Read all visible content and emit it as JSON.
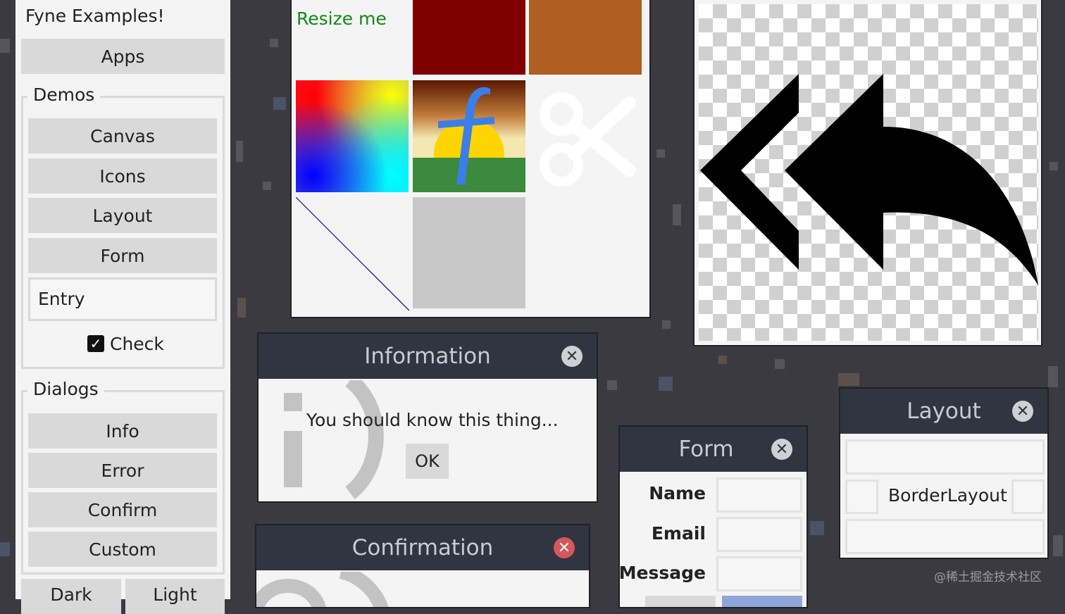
{
  "sidebar": {
    "title": "Fyne Examples!",
    "apps_label": "Apps",
    "demos_group": "Demos",
    "demos": [
      "Canvas",
      "Icons",
      "Layout",
      "Form"
    ],
    "entry_placeholder": "Entry",
    "check_label": "Check",
    "check_checked": true,
    "dialogs_group": "Dialogs",
    "dialogs": [
      "Info",
      "Error",
      "Confirm",
      "Custom"
    ],
    "theme_buttons": [
      "Dark",
      "Light"
    ]
  },
  "canvas_window": {
    "resize_text": "Resize me",
    "colors": {
      "dark_red": "#800000",
      "orange": "#b05e22",
      "text_green": "#138913",
      "gray": "#c8c8c8",
      "line": "#1a1aa0"
    }
  },
  "icon_window": {
    "icon": "mail-reply-all-icon"
  },
  "info_dialog": {
    "title": "Information",
    "message": "You should know this thing...",
    "ok_label": "OK"
  },
  "confirm_dialog": {
    "title": "Confirmation"
  },
  "form_dialog": {
    "title": "Form",
    "fields": [
      "Name",
      "Email",
      "Message"
    ]
  },
  "layout_dialog": {
    "title": "Layout",
    "center_label": "BorderLayout"
  },
  "watermark": "@稀土掘金技术社区"
}
